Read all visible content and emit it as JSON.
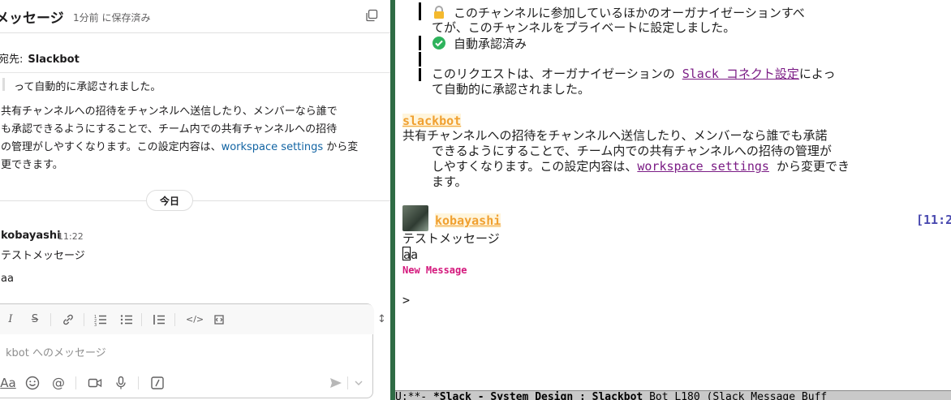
{
  "left": {
    "header": {
      "title": "メッセージ",
      "saved": "1分前 に保存済み"
    },
    "to_label": "宛先:",
    "to_name": "Slackbot",
    "quote_text": "って自動的に承認されました。",
    "para_lines": [
      "共有チャンネルへの招待をチャンネルへ送信したり、メンバーなら誰で",
      "も承認できるようにすることで、チーム内での共有チャンネルへの招待",
      "の管理がしやすくなります。この設定内容は、",
      "更できます。"
    ],
    "para_link": "workspace settings",
    "para_after_link": " から変",
    "day_divider": "今日",
    "message": {
      "author": "kobayashi",
      "time": "11:22",
      "line1": "テストメッセージ",
      "line2": "aa"
    },
    "composer": {
      "placeholder": "kbot へのメッセージ",
      "format_label": "Aa"
    }
  },
  "right": {
    "line_a": "このチャンネルに参加しているほかのオーガナイゼーションすべ",
    "line_b": "てが、このチャンネルをプライベートに設定しました。",
    "line_c": "自動承認済み",
    "line_d_pre": "このリクエストは、オーガナイゼーションの ",
    "line_d_link": "Slack コネクト設定",
    "line_d_post": "によっ",
    "line_e": "て自動的に承認されました。",
    "bot_name": "slackbot",
    "bot_line1": "共有チャンネルへの招待をチャンネルへ送信したり、メンバーなら誰でも承諾",
    "bot_line2": "できるようにすることで、チーム内での共有チャンネルへの招待の管理が",
    "bot_line3_pre": "しやすくなります。この設定内容は、",
    "bot_line3_link": "workspace settings",
    "bot_line3_post": " から変更でき",
    "bot_line4": "ます。",
    "user_name": "kobayashi",
    "timestamp": "[11:2",
    "user_line1": "テストメッセージ",
    "user_line2": "aa",
    "new_message": "New Message",
    "prompt": ">",
    "modeline": {
      "state": " U:**-  ",
      "buffer": "*Slack - System Design : Slackbot",
      "rest": "   Bot   L180   (Slack Message Buff"
    }
  },
  "colors": {
    "divider": "#2f6c45",
    "link": "#1264a3",
    "emacs_link": "#7b1c85",
    "sender": "#f0a030",
    "new_message": "#d4177c",
    "timestamp": "#4a4ab0"
  }
}
